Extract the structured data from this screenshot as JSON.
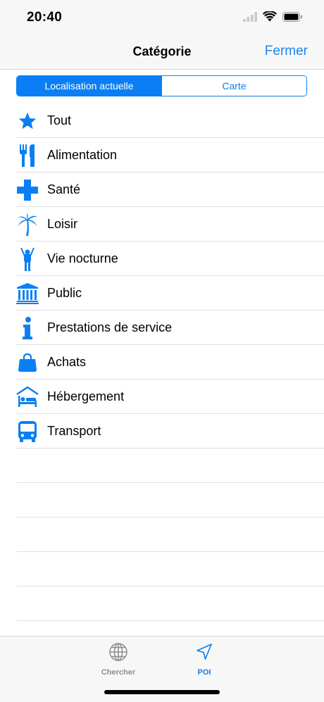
{
  "status": {
    "time": "20:40"
  },
  "nav": {
    "title": "Catégorie",
    "close_label": "Fermer"
  },
  "segments": {
    "current": "Localisation actuelle",
    "map": "Carte"
  },
  "categories": [
    {
      "label": "Tout",
      "icon": "star-icon"
    },
    {
      "label": "Alimentation",
      "icon": "fork-knife-icon"
    },
    {
      "label": "Santé",
      "icon": "health-cross-icon"
    },
    {
      "label": "Loisir",
      "icon": "palm-tree-icon"
    },
    {
      "label": "Vie nocturne",
      "icon": "nightlife-person-icon"
    },
    {
      "label": "Public",
      "icon": "public-building-icon"
    },
    {
      "label": "Prestations de service",
      "icon": "info-icon"
    },
    {
      "label": "Achats",
      "icon": "shopping-bag-icon"
    },
    {
      "label": "Hébergement",
      "icon": "bed-icon"
    },
    {
      "label": "Transport",
      "icon": "bus-icon"
    }
  ],
  "tabs": [
    {
      "label": "Chercher",
      "icon": "globe-icon",
      "selected": false
    },
    {
      "label": "POI",
      "icon": "location-arrow-icon",
      "selected": true
    }
  ],
  "colors": {
    "accent": "#0a7ff5",
    "inactive_tab": "#8e8e93",
    "bar_background": "#f7f7f7"
  }
}
